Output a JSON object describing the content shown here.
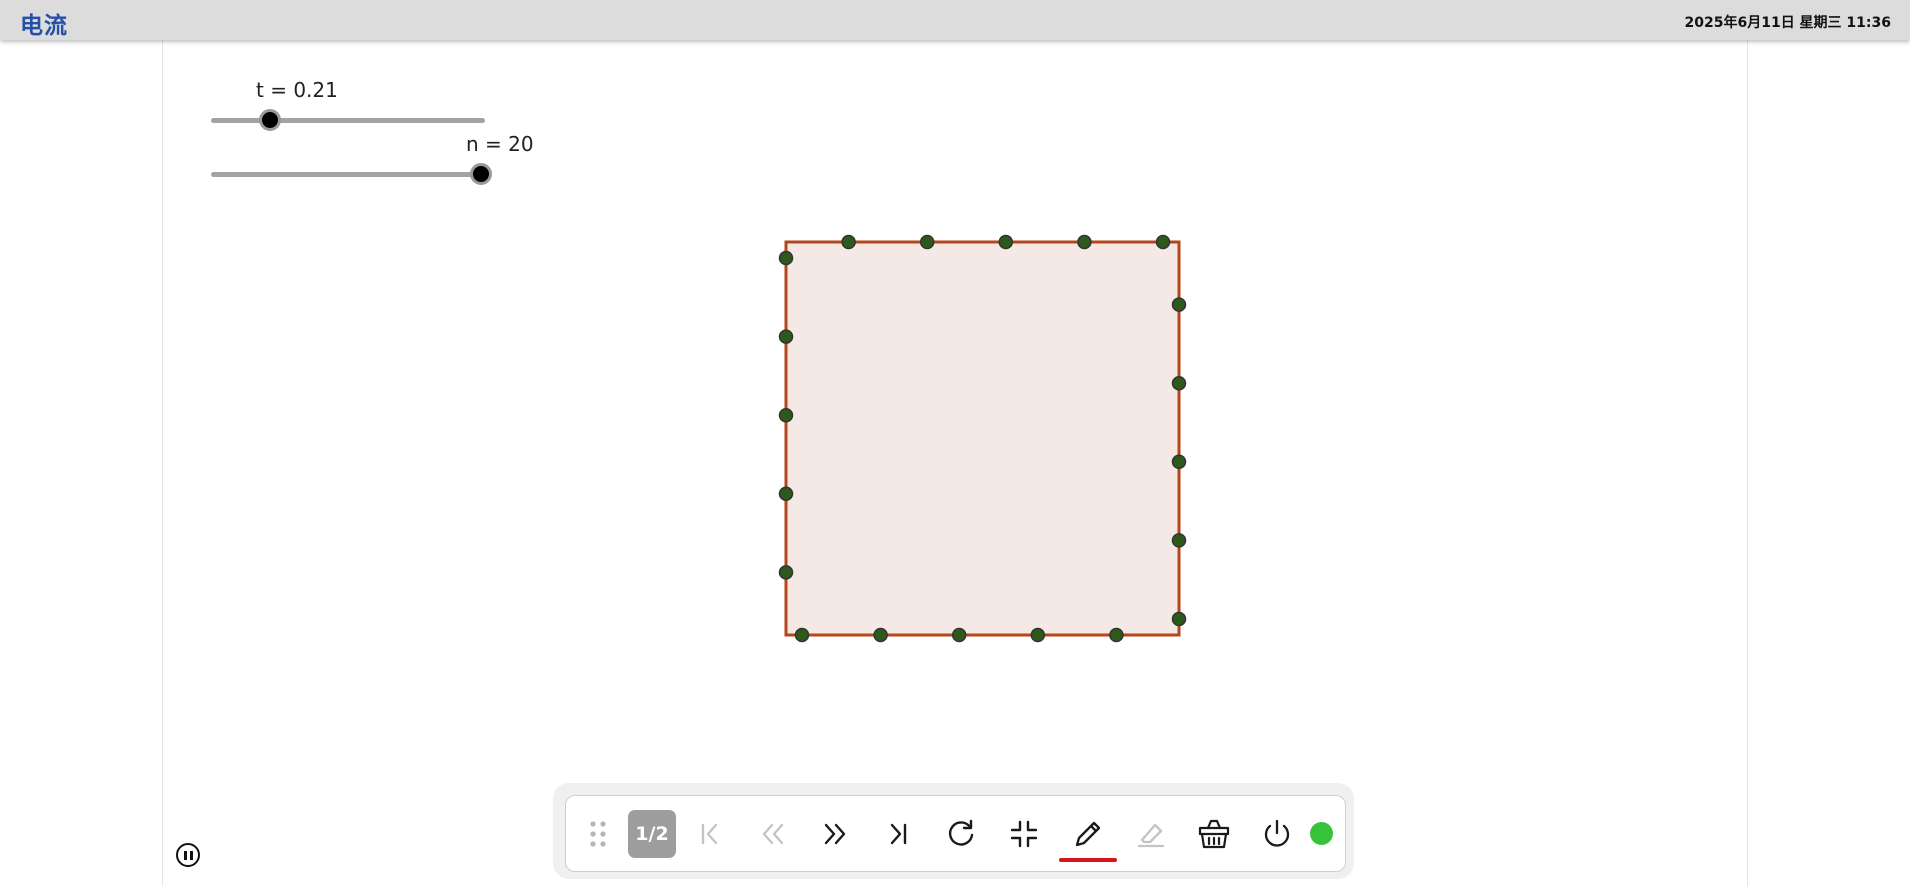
{
  "app": {
    "title": "电流",
    "datetime": "2025年6月11日 星期三 11:36"
  },
  "sliders": {
    "t": {
      "label": "t = 0.21",
      "value": 0.21,
      "fraction": 0.18
    },
    "n": {
      "label": "n = 20",
      "value": 20,
      "fraction": 1.0
    }
  },
  "figure": {
    "shape": "square",
    "fill_color": "#f5e9e6",
    "stroke_color": "#b5461a",
    "point_color": "#2d5a1b",
    "point_count": 20
  },
  "toolbar": {
    "page_indicator": "1/2",
    "icons": {
      "drag": "drag-handle-icon",
      "first": "first-page-icon",
      "prev": "previous-icon",
      "next": "next-icon",
      "last": "last-page-icon",
      "reload": "reload-icon",
      "exit_fullscreen": "exit-fullscreen-icon",
      "pen": "pen-icon",
      "eraser": "eraser-icon",
      "clear": "clear-basket-icon",
      "power": "power-icon"
    },
    "status_color": "#36c33a",
    "pen_color": "#d8141b"
  }
}
